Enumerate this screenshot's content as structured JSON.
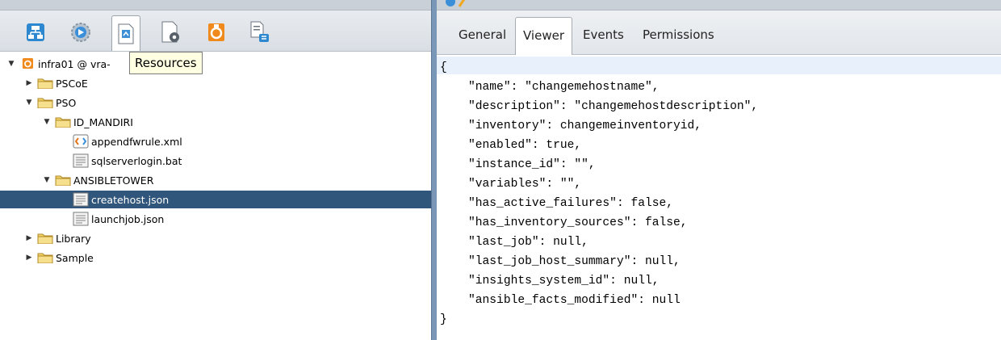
{
  "left": {
    "toolbar_icons": [
      "workflow-icon",
      "action-icon",
      "resource-icon",
      "configuration-icon",
      "package-icon",
      "policy-icon"
    ],
    "tooltip": "Resources",
    "tree": [
      {
        "label": "infra01 @ vra-",
        "depth": 0,
        "arrow": "▼",
        "icon": "server-icon"
      },
      {
        "label": "PSCoE",
        "depth": 1,
        "arrow": "▶",
        "icon": "folder-icon"
      },
      {
        "label": "PSO",
        "depth": 1,
        "arrow": "▼",
        "icon": "folder-icon"
      },
      {
        "label": "ID_MANDIRI",
        "depth": 2,
        "arrow": "▼",
        "icon": "folder-icon"
      },
      {
        "label": "appendfwrule.xml",
        "depth": 3,
        "arrow": "",
        "icon": "xml-file-icon"
      },
      {
        "label": "sqlserverlogin.bat",
        "depth": 3,
        "arrow": "",
        "icon": "text-file-icon"
      },
      {
        "label": "ANSIBLETOWER",
        "depth": 2,
        "arrow": "▼",
        "icon": "folder-icon"
      },
      {
        "label": "createhost.json",
        "depth": 3,
        "arrow": "",
        "icon": "text-file-icon",
        "selected": true
      },
      {
        "label": "launchjob.json",
        "depth": 3,
        "arrow": "",
        "icon": "text-file-icon"
      },
      {
        "label": "Library",
        "depth": 1,
        "arrow": "▶",
        "icon": "folder-icon"
      },
      {
        "label": "Sample",
        "depth": 1,
        "arrow": "▶",
        "icon": "folder-icon"
      }
    ]
  },
  "right": {
    "tabs": [
      "General",
      "Viewer",
      "Events",
      "Permissions"
    ],
    "active_tab": "Viewer",
    "code_lines": [
      "{",
      "    \"name\": \"changemehostname\",",
      "    \"description\": \"changemehostdescription\",",
      "    \"inventory\": changemeinventoryid,",
      "    \"enabled\": true,",
      "    \"instance_id\": \"\",",
      "    \"variables\": \"\",",
      "    \"has_active_failures\": false,",
      "    \"has_inventory_sources\": false,",
      "    \"last_job\": null,",
      "    \"last_job_host_summary\": null,",
      "    \"insights_system_id\": null,",
      "    \"ansible_facts_modified\": null",
      "}"
    ]
  },
  "colors": {
    "selection": "#31567c",
    "splitter": "#7b97b8",
    "tooltip": "#ffffe1",
    "folder": "#f3d36b"
  }
}
